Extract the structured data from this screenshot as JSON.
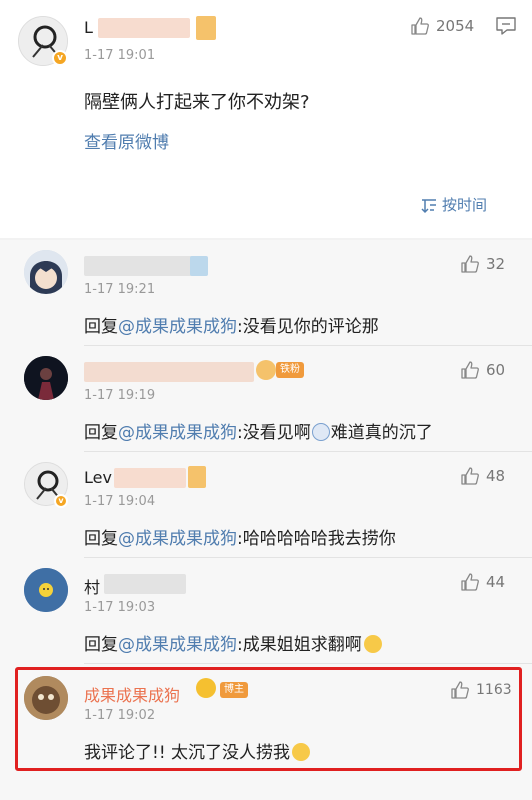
{
  "post": {
    "author_partial": "L",
    "time": "1-17 19:01",
    "likes": "2054",
    "text": "隔壁俩人打起来了你不劝架?",
    "view_original": "查看原微博",
    "sort_label": "按时间",
    "icons": {
      "like": "thumb-up-icon",
      "comment": "comment-icon",
      "sort": "sort-icon"
    }
  },
  "comments": [
    {
      "name": "",
      "time": "1-17 19:21",
      "likes": "32",
      "reply_prefix": "回复",
      "mention": "@成果成果成狗",
      "body": ":没看见你的评论那"
    },
    {
      "name": "",
      "time": "1-17 19:19",
      "likes": "60",
      "badge": "铁粉",
      "reply_prefix": "回复",
      "mention": "@成果成果成狗",
      "body_a": ":没看见啊",
      "body_b": "难道真的沉了"
    },
    {
      "name": "Lev",
      "time": "1-17 19:04",
      "likes": "48",
      "reply_prefix": "回复",
      "mention": "@成果成果成狗",
      "body": ":哈哈哈哈哈我去捞你"
    },
    {
      "name": "村",
      "time": "1-17 19:03",
      "likes": "44",
      "reply_prefix": "回复",
      "mention": "@成果成果成狗",
      "body": ":成果姐姐求翻啊"
    },
    {
      "name": "成果成果成狗",
      "time": "1-17 19:02",
      "likes": "1163",
      "badge": "博主",
      "body": "我评论了!! 太沉了没人捞我"
    }
  ],
  "colors": {
    "link": "#507daf",
    "author": "#eb7350",
    "highlight": "#e02020"
  }
}
